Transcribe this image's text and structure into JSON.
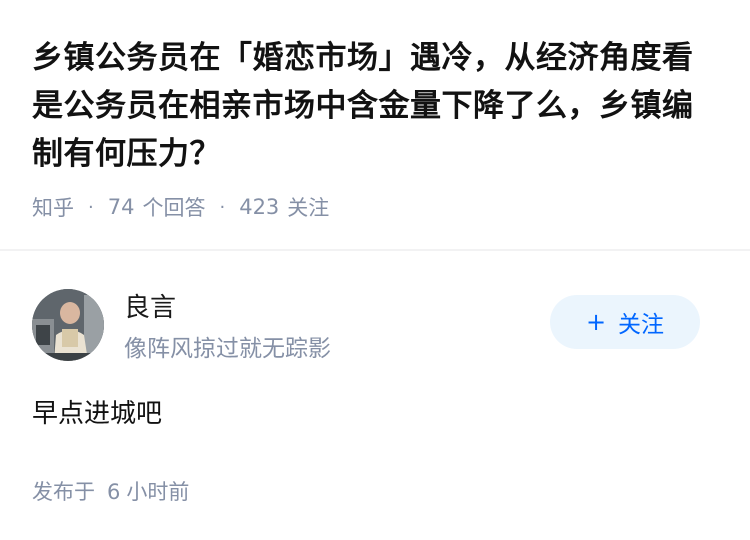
{
  "question": {
    "title": "乡镇公务员在「婚恋市场」遇冷，从经济角度看是公务员在相亲市场中含金量下降了么，乡镇编制有何压力？",
    "source": "知乎",
    "separator": "·",
    "answer_count": "74",
    "answer_unit": "个回答",
    "follower_count": "423",
    "follower_unit": "关注"
  },
  "author": {
    "name": "良言",
    "bio": "像阵风掠过就无踪影",
    "avatar_icon": "user-avatar-photo",
    "follow_button": {
      "icon": "+",
      "label": "关注"
    },
    "colors": {
      "follow_bg": "#ebf5fd",
      "follow_text": "#0066ff"
    }
  },
  "answer": {
    "content": "早点进城吧",
    "published_prefix": "发布于",
    "published_amount": "6",
    "published_unit": "小时前"
  }
}
